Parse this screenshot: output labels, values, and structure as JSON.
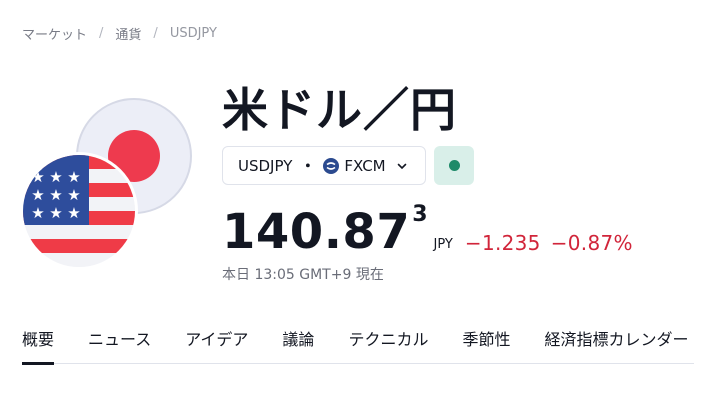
{
  "breadcrumb": {
    "items": [
      "マーケット",
      "通貨",
      "USDJPY"
    ],
    "separator": "/"
  },
  "instrument": {
    "title": "米ドル／円",
    "symbol": "USDJPY",
    "symbol_separator": "・",
    "exchange": "FXCM",
    "market_status_color": "#1e8a69"
  },
  "quote": {
    "price": "140.87",
    "price_superscript": "3",
    "currency": "JPY",
    "change": "−1.235",
    "change_percent": "−0.87%",
    "change_color": "#d1253a",
    "timestamp": "本日 13:05 GMT+9 現在"
  },
  "tabs": [
    {
      "label": "概要",
      "active": true
    },
    {
      "label": "ニュース",
      "active": false
    },
    {
      "label": "アイデア",
      "active": false
    },
    {
      "label": "議論",
      "active": false
    },
    {
      "label": "テクニカル",
      "active": false
    },
    {
      "label": "季節性",
      "active": false
    },
    {
      "label": "経済指標カレンダー",
      "active": false
    }
  ],
  "icons": {
    "flag_base": "japan-flag-icon",
    "flag_quote": "us-flag-icon",
    "exchange": "fxcm-icon",
    "dropdown": "chevron-down-icon"
  }
}
